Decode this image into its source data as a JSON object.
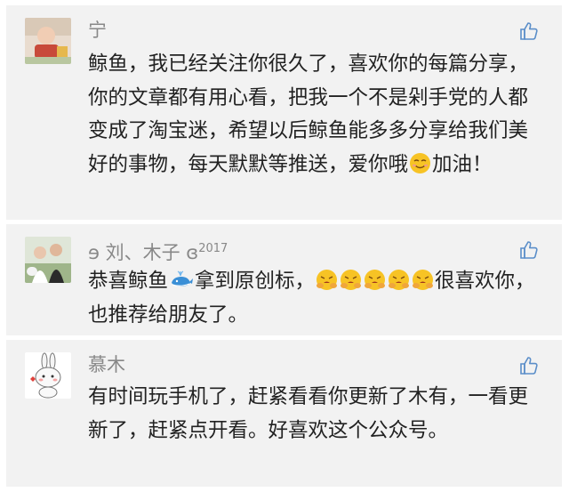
{
  "comments": [
    {
      "user": "宁",
      "text_before": "鲸鱼，我已经关注你很久了，喜欢你的每篇分享，你的文章都有用心看，把我一个不是剁手党的人都变成了淘宝迷，希望以后鲸鱼能多多分享给我们美好的事物，每天默默等推送，爱你哦",
      "emoji_1": "smile-emoji",
      "text_after": "加油！"
    },
    {
      "user": "ɘ 刘、木子 ɞ",
      "user_sup": "2017",
      "text_before": "恭喜鲸鱼",
      "emoji_1": "whale-emoji",
      "text_middle": "拿到原创标，",
      "emoji_2": "clapping-face-emoji",
      "text_after": "很喜欢你，也推荐给朋友了。"
    },
    {
      "user": "慕木",
      "text": "有时间玩手机了，赶紧看看你更新了木有，一看更新了，赶紧点开看。好喜欢这个公众号。"
    }
  ],
  "like_icon": "thumbs-up-icon",
  "colors": {
    "card": "#f2f2f2",
    "name": "#888888",
    "text": "#222222",
    "like": "#5b8ec9"
  }
}
